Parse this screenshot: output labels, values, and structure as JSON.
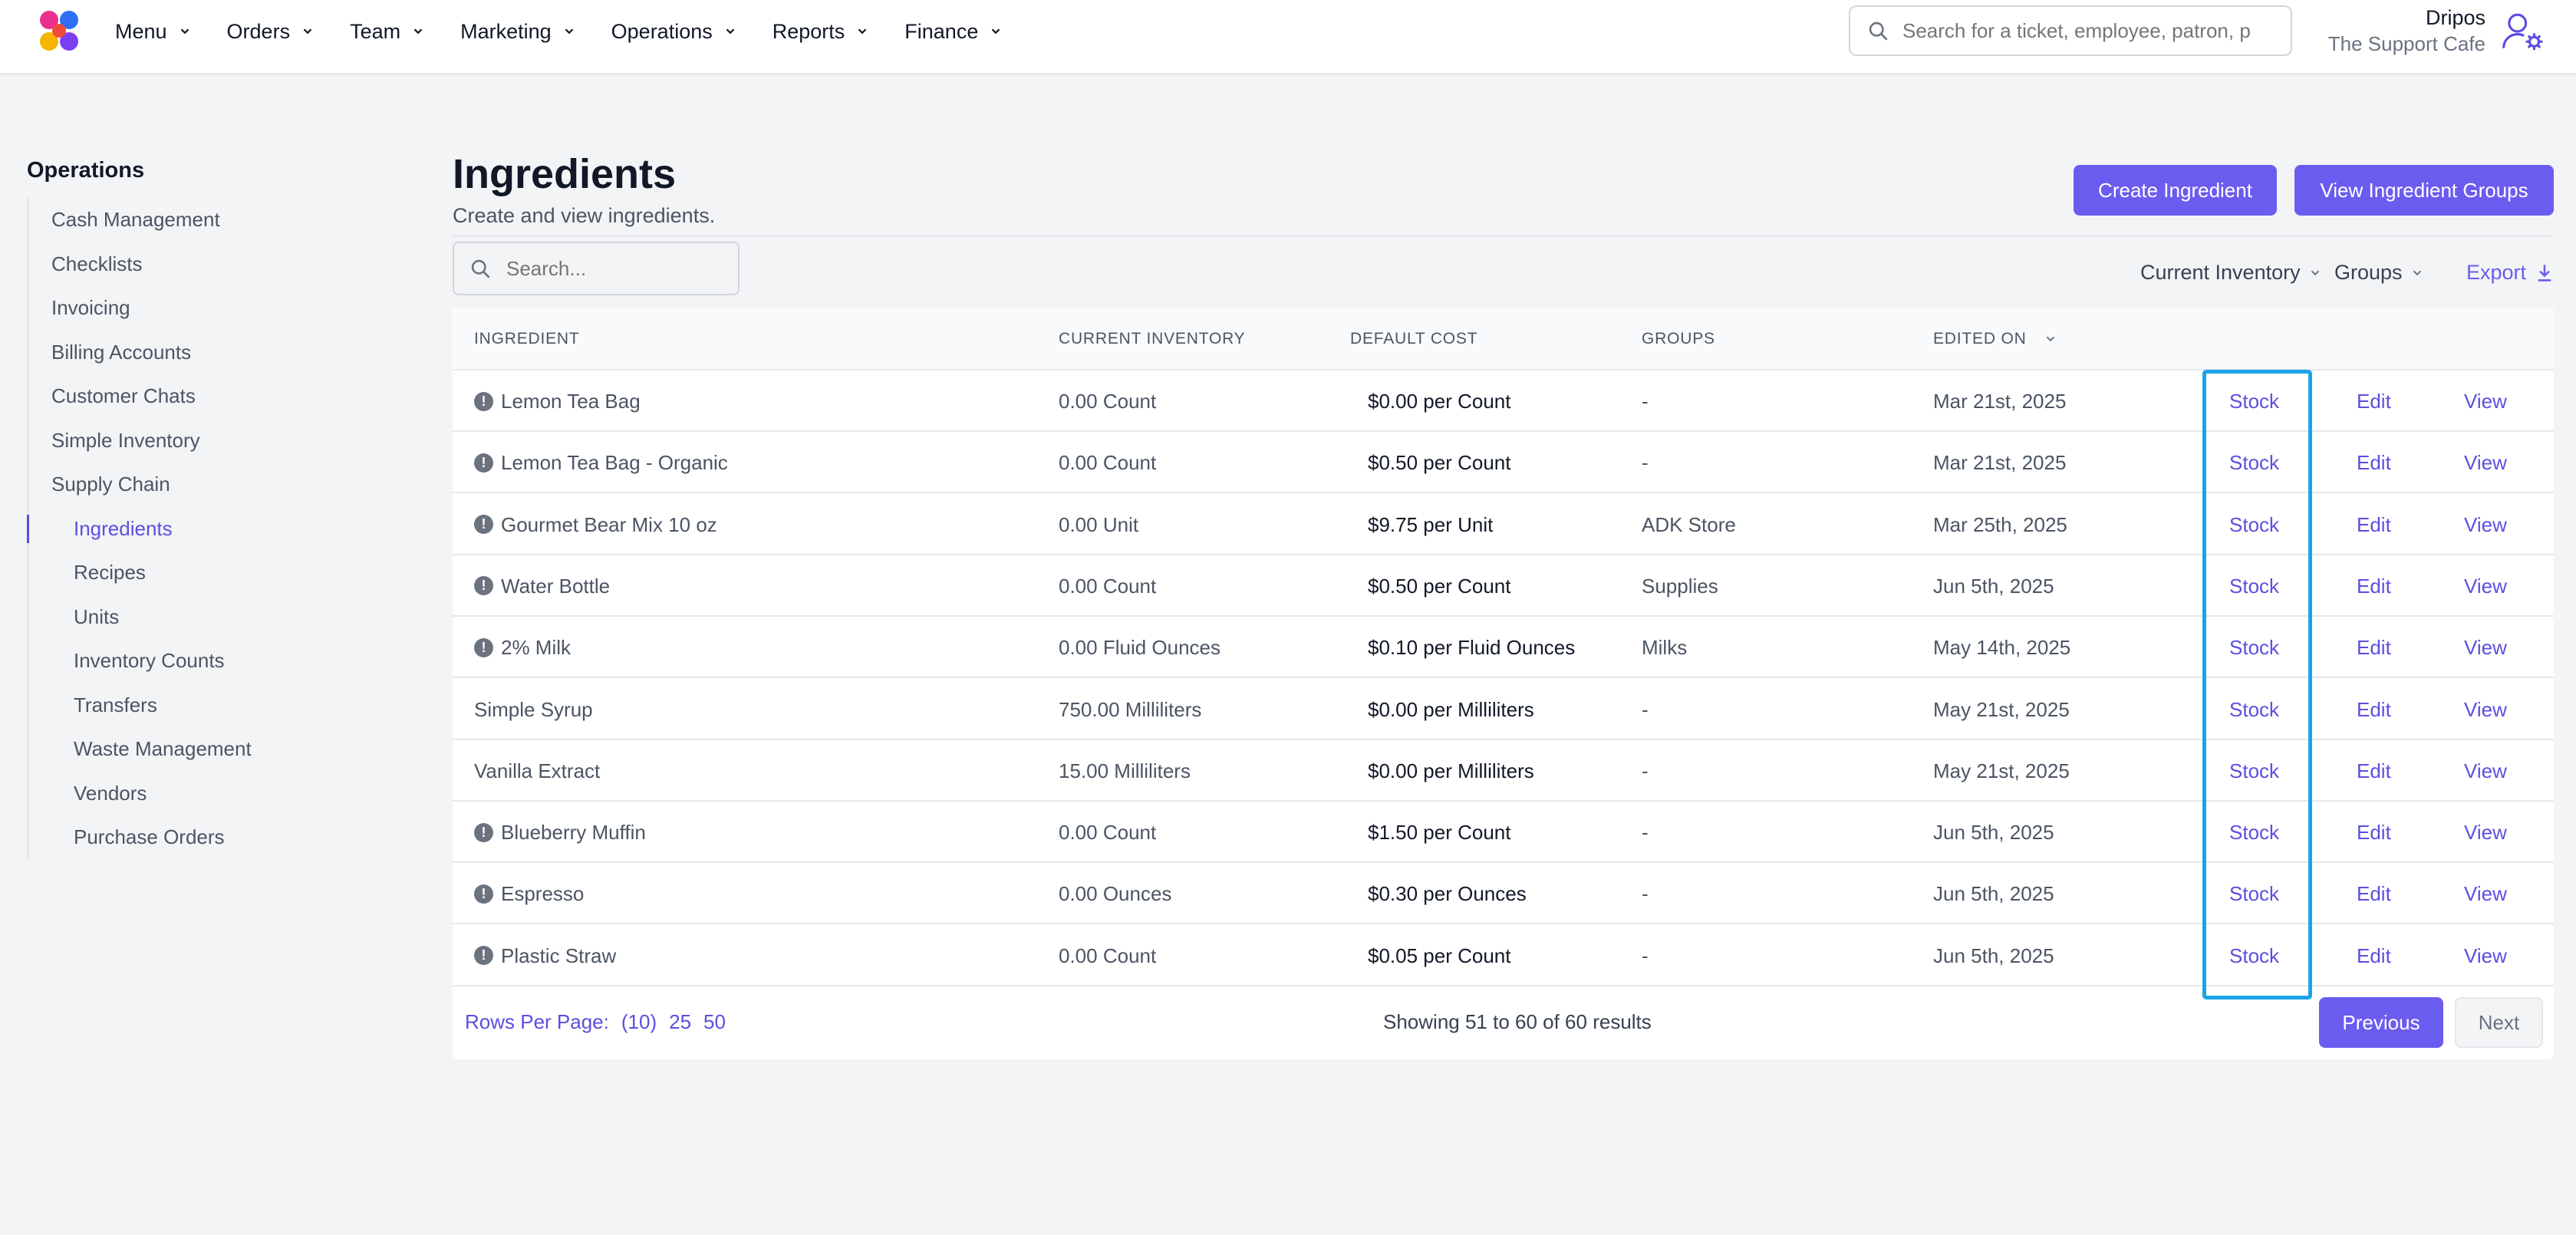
{
  "nav": {
    "items": [
      {
        "label": "Menu",
        "name": "nav-menu"
      },
      {
        "label": "Orders",
        "name": "nav-orders"
      },
      {
        "label": "Team",
        "name": "nav-team"
      },
      {
        "label": "Marketing",
        "name": "nav-marketing"
      },
      {
        "label": "Operations",
        "name": "nav-operations"
      },
      {
        "label": "Reports",
        "name": "nav-reports"
      },
      {
        "label": "Finance",
        "name": "nav-finance"
      }
    ],
    "search_placeholder": "Search for a ticket, employee, patron, p",
    "user_name": "Dripos",
    "org_name": "The Support Cafe"
  },
  "sidebar": {
    "title": "Operations",
    "items": [
      {
        "label": "Cash Management",
        "sub": false,
        "active": false
      },
      {
        "label": "Checklists",
        "sub": false,
        "active": false
      },
      {
        "label": "Invoicing",
        "sub": false,
        "active": false
      },
      {
        "label": "Billing Accounts",
        "sub": false,
        "active": false
      },
      {
        "label": "Customer Chats",
        "sub": false,
        "active": false
      },
      {
        "label": "Simple Inventory",
        "sub": false,
        "active": false
      },
      {
        "label": "Supply Chain",
        "sub": false,
        "active": false
      },
      {
        "label": "Ingredients",
        "sub": true,
        "active": true
      },
      {
        "label": "Recipes",
        "sub": true,
        "active": false
      },
      {
        "label": "Units",
        "sub": true,
        "active": false
      },
      {
        "label": "Inventory Counts",
        "sub": true,
        "active": false
      },
      {
        "label": "Transfers",
        "sub": true,
        "active": false
      },
      {
        "label": "Waste Management",
        "sub": true,
        "active": false
      },
      {
        "label": "Vendors",
        "sub": true,
        "active": false
      },
      {
        "label": "Purchase Orders",
        "sub": true,
        "active": false
      }
    ]
  },
  "page": {
    "title": "Ingredients",
    "subtitle": "Create and view ingredients.",
    "create_label": "Create Ingredient",
    "groups_label": "View Ingredient Groups"
  },
  "toolbar": {
    "search_placeholder": "Search...",
    "filter_inventory": "Current Inventory",
    "filter_groups": "Groups",
    "export_label": "Export"
  },
  "table": {
    "headers": {
      "ingredient": "INGREDIENT",
      "inventory": "CURRENT INVENTORY",
      "cost": "DEFAULT COST",
      "groups": "GROUPS",
      "edited": "EDITED ON"
    },
    "action_stock": "Stock",
    "action_edit": "Edit",
    "action_view": "View",
    "rows": [
      {
        "name": "Lemon Tea Bag",
        "warn": true,
        "inventory": "0.00 Count",
        "cost": "$0.00 per Count",
        "groups": "-",
        "edited": "Mar 21st, 2025"
      },
      {
        "name": "Lemon Tea Bag - Organic",
        "warn": true,
        "inventory": "0.00 Count",
        "cost": "$0.50 per Count",
        "groups": "-",
        "edited": "Mar 21st, 2025"
      },
      {
        "name": "Gourmet Bear Mix 10 oz",
        "warn": true,
        "inventory": "0.00 Unit",
        "cost": "$9.75 per Unit",
        "groups": "ADK Store",
        "edited": "Mar 25th, 2025"
      },
      {
        "name": "Water Bottle",
        "warn": true,
        "inventory": "0.00 Count",
        "cost": "$0.50 per Count",
        "groups": "Supplies",
        "edited": "Jun 5th, 2025"
      },
      {
        "name": "2% Milk",
        "warn": true,
        "inventory": "0.00 Fluid Ounces",
        "cost": "$0.10 per Fluid Ounces",
        "groups": "Milks",
        "edited": "May 14th, 2025"
      },
      {
        "name": "Simple Syrup",
        "warn": false,
        "inventory": "750.00 Milliliters",
        "cost": "$0.00 per Milliliters",
        "groups": "-",
        "edited": "May 21st, 2025"
      },
      {
        "name": "Vanilla Extract",
        "warn": false,
        "inventory": "15.00 Milliliters",
        "cost": "$0.00 per Milliliters",
        "groups": "-",
        "edited": "May 21st, 2025"
      },
      {
        "name": "Blueberry Muffin",
        "warn": true,
        "inventory": "0.00 Count",
        "cost": "$1.50 per Count",
        "groups": "-",
        "edited": "Jun 5th, 2025"
      },
      {
        "name": "Espresso",
        "warn": true,
        "inventory": "0.00 Ounces",
        "cost": "$0.30 per Ounces",
        "groups": "-",
        "edited": "Jun 5th, 2025"
      },
      {
        "name": "Plastic Straw",
        "warn": true,
        "inventory": "0.00 Count",
        "cost": "$0.05 per Count",
        "groups": "-",
        "edited": "Jun 5th, 2025"
      }
    ]
  },
  "footer": {
    "rows_per_page_label": "Rows Per Page:",
    "rpp_options": [
      "(10)",
      "25",
      "50"
    ],
    "showing": "Showing 51 to 60 of 60 results",
    "prev_label": "Previous",
    "next_label": "Next"
  },
  "colors": {
    "accent": "#6b5cf0",
    "highlight": "#1aa3e8"
  }
}
